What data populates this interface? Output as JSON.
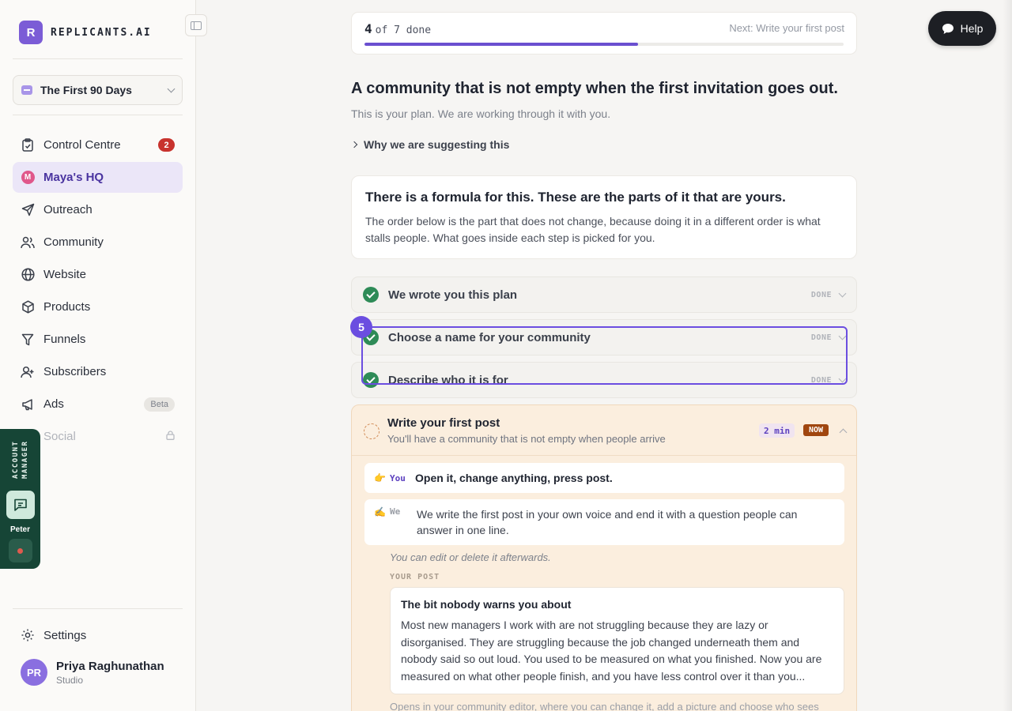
{
  "brand": {
    "mark": "R",
    "name": "REPLICANTS.AI"
  },
  "project": {
    "name": "The First 90 Days"
  },
  "nav": [
    {
      "label": "Control Centre",
      "icon": "clipboard-icon",
      "badge": "2"
    },
    {
      "label": "Maya's HQ",
      "icon": "maya-avatar-icon",
      "mark": "M",
      "active": true
    },
    {
      "label": "Outreach",
      "icon": "send-icon"
    },
    {
      "label": "Community",
      "icon": "people-icon"
    },
    {
      "label": "Website",
      "icon": "globe-icon"
    },
    {
      "label": "Products",
      "icon": "box-icon"
    },
    {
      "label": "Funnels",
      "icon": "funnel-icon"
    },
    {
      "label": "Subscribers",
      "icon": "subscribers-icon"
    },
    {
      "label": "Ads",
      "icon": "megaphone-icon",
      "badge": "Beta"
    },
    {
      "label": "Social",
      "icon": "social-icon",
      "locked": true
    }
  ],
  "settings": {
    "label": "Settings"
  },
  "user": {
    "initials": "PR",
    "name": "Priya Raghunathan",
    "plan": "Studio"
  },
  "account_manager": {
    "label": "ACCOUNT MANAGER",
    "name": "Peter"
  },
  "help": {
    "label": "Help"
  },
  "progress": {
    "done": "4",
    "text": "of 7 done",
    "next": "Next: Write your first post",
    "fraction": 0.5714
  },
  "headline": "A community that is not empty when the first invitation goes out.",
  "subline": "This is your plan. We are working through it with you.",
  "why_label": "Why we are suggesting this",
  "formula": {
    "title": "There is a formula for this. These are the parts of it that are yours.",
    "body": "The order below is the part that does not change, because doing it in a different order is what stalls people. What goes inside each step is picked for you."
  },
  "steps": [
    {
      "title": "We wrote you this plan",
      "status": "DONE"
    },
    {
      "title": "Choose a name for your community",
      "status": "DONE"
    },
    {
      "title": "Describe who it is for",
      "status": "DONE"
    }
  ],
  "highlight_badge": "5",
  "active_step": {
    "title": "Write your first post",
    "subtitle": "You'll have a community that is not empty when people arrive",
    "time": "2 min",
    "status": "NOW",
    "you": {
      "emoji": "👉",
      "who": "You",
      "text": "Open it, change anything, press post."
    },
    "we": {
      "emoji": "✍",
      "who": "We",
      "text": "We write the first post in your own voice and end it with a question people can answer in one line."
    },
    "edit_note": "You can edit or delete it afterwards.",
    "post_label": "YOUR POST",
    "post": {
      "title": "The bit nobody warns you about",
      "body": "Most new managers I work with are not struggling because they are lazy or disorganised. They are struggling because the job changed underneath them and nobody said so out loud. You used to be measured on what you finished. Now you are measured on what other people finish, and you have less control over it than you..."
    },
    "footnote": "Opens in your community editor, where you can change it, add a picture and choose who sees"
  }
}
